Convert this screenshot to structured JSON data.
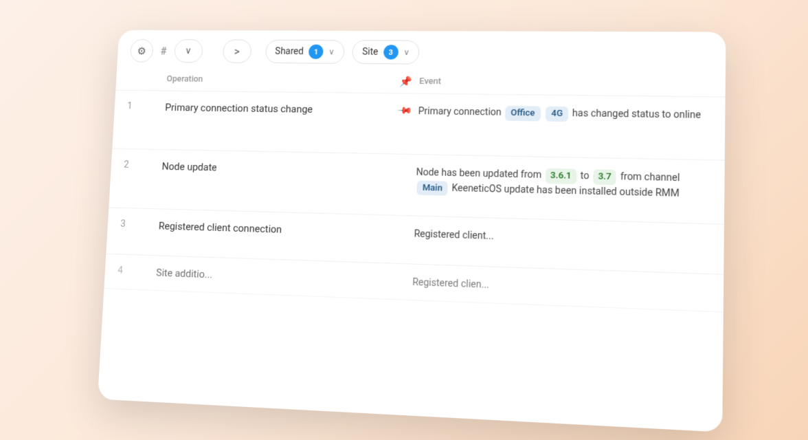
{
  "toolbar": {
    "gear_icon": "⚙",
    "hash_icon": "#",
    "chevron_down_icon": "∨",
    "nav_forward_icon": ">",
    "shared_label": "Shared",
    "shared_badge": "1",
    "site_label": "Site",
    "site_badge": "3"
  },
  "table": {
    "col_operation": "Operation",
    "col_event": "Event",
    "rows": [
      {
        "num": "1",
        "operation": "Primary connection status change",
        "event_parts": [
          {
            "text": "Primary connection ",
            "type": "text"
          },
          {
            "text": "Office",
            "type": "tag"
          },
          {
            "text": " ",
            "type": "text"
          },
          {
            "text": "4G",
            "type": "tag"
          },
          {
            "text": " has changed status to online",
            "type": "text"
          }
        ]
      },
      {
        "num": "2",
        "operation": "Node update",
        "event_parts": [
          {
            "text": "Node has been updated from ",
            "type": "text"
          },
          {
            "text": "3.6.1",
            "type": "tag-version"
          },
          {
            "text": " to ",
            "type": "text"
          },
          {
            "text": "3.7",
            "type": "tag-version"
          },
          {
            "text": " from channel ",
            "type": "text"
          },
          {
            "text": "Main",
            "type": "tag"
          },
          {
            "text": " KeeneticOS update has been installed outside RMM",
            "type": "text"
          }
        ]
      },
      {
        "num": "3",
        "operation": "Registered client connection",
        "event_parts": [
          {
            "text": "Registered client...",
            "type": "text"
          }
        ]
      },
      {
        "num": "4",
        "operation": "Site additio...",
        "event_parts": [
          {
            "text": "Registered clien...",
            "type": "text"
          }
        ]
      }
    ]
  }
}
